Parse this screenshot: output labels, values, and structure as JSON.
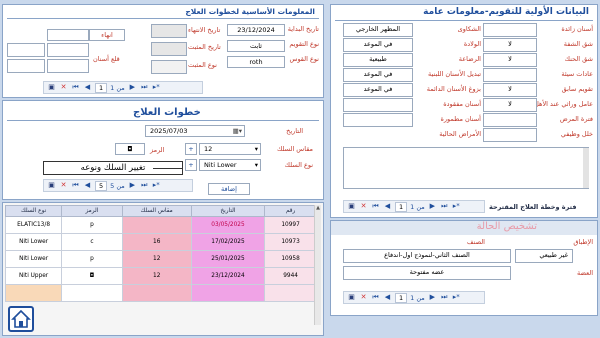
{
  "left": {
    "title": "المعلومات الأساسية لخطوات العلاج",
    "start_date_label": "تاريخ البداية",
    "start_date_value": "23/12/2024",
    "treatment_type_label": "نوع التقويم",
    "treatment_type_value": "ثابت",
    "arch_type_label": "نوع القوس",
    "arch_type_value": "roth",
    "end_date_label": "تاريخ الانتهاء",
    "retainer_date_label": "تاريخ المثبت",
    "retainer_type_label": "نوع المثبت",
    "status_value": "انهاء",
    "extraction_label": "قلع أسنان",
    "nav1": {
      "page": "1",
      "of": "من 1"
    },
    "steps_title": "خطوات العلاج",
    "date_label": "التاريخ",
    "date_value": "2025/07/03",
    "size_label": "مقاس السلك",
    "size_value": "12",
    "symbol_label": "الرمز",
    "wire_type_label": "نوع السلك",
    "wire_type_value": "Niti Lower",
    "annotation": "تغيير السلك ونوعه",
    "nav2": {
      "page": "5",
      "of": "من 5"
    },
    "add_button": "إضافة",
    "table": {
      "headers": [
        "رقم",
        "التاريخ",
        "مقاس السلك",
        "الرمز",
        "نوع السلك"
      ],
      "rows": [
        {
          "num": "10997",
          "date": "03/05/2025",
          "size": "",
          "symbol": "p",
          "type": "ELATIC13/8"
        },
        {
          "num": "10973",
          "date": "17/02/2025",
          "size": "16",
          "symbol": "c",
          "type": "Niti Lower"
        },
        {
          "num": "10958",
          "date": "25/01/2025",
          "size": "12",
          "symbol": "p",
          "type": "Niti Lower"
        },
        {
          "num": "9944",
          "date": "23/12/2024",
          "size": "12",
          "symbol": "◘",
          "type": "Niti Upper"
        }
      ]
    }
  },
  "right": {
    "title": "البيانات الأولية للتقويم-معلومات عامة",
    "col1_labels": [
      "أسنان زائدة",
      "شق الشفة",
      "شق الحنك",
      "عادات سيئة",
      "تقويم سابق",
      "عامل وراثي عند الأهل",
      "فترة المرض",
      "خلل وظيفي"
    ],
    "col1_values": [
      "",
      "لا",
      "لا",
      "",
      "لا",
      "لا",
      "",
      ""
    ],
    "col2_labels": [
      "الشكاوى",
      "الولادة",
      "الرضاعة",
      "تبديل الأسنان اللبنية",
      "بزوغ الأسنان الدائمة",
      "أسنان مفقودة",
      "أسنان مطمورة",
      "الأمراض الحالية"
    ],
    "col2_values": [
      "المظهر الخارجي",
      "في الموعد",
      "طبيعية",
      "في الموعد",
      "في الموعد",
      "",
      "",
      ""
    ],
    "plan_label": "فترة وخطة العلاج المقترحة",
    "nav3": {
      "page": "1",
      "of": "من 1"
    },
    "diagnosis_title": "تشخيص الحالة",
    "class_label": "الصنف",
    "overlap_label": "الإطباق",
    "overlap_value": "غير طبيعي",
    "class_value": "الصنف الثاني-لنموذج اول-اندفاع",
    "bite_label": "العضة",
    "bite_value": "عضه مفتوحة",
    "nav4": {
      "page": "1",
      "of": "من 1"
    }
  },
  "icons": {
    "home": "home-icon",
    "save": "save-icon",
    "delete": "delete-icon",
    "first": "first-icon",
    "prev": "prev-icon",
    "next": "next-icon",
    "last": "last-icon",
    "new": "new-record-icon"
  }
}
